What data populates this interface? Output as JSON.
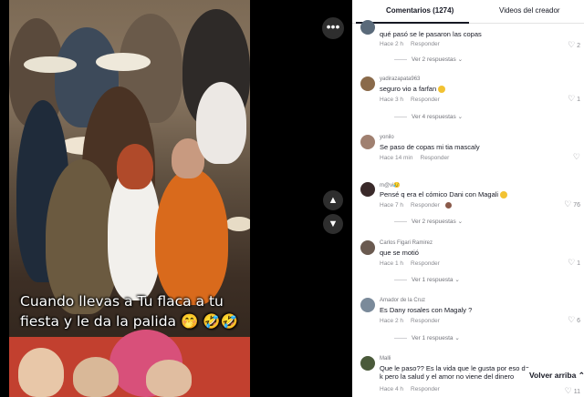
{
  "video": {
    "caption": "Cuando llevas a Tu flaca a tu fiesta y le da la palida 🤭 🤣🤣"
  },
  "tabs": [
    {
      "label": "Comentarios (1274)",
      "active": true
    },
    {
      "label": "Videos del creador",
      "active": false
    }
  ],
  "comments": [
    {
      "user": "",
      "text": "qué pasó se le pasaron las copas",
      "time": "Hace 2 h",
      "reply_label": "Responder",
      "likes": "2",
      "replies": "Ver 2 respuestas",
      "avatar_color": "#5a6a7a"
    },
    {
      "user": "yadirazapata963",
      "text": "seguro vio a farfan",
      "time": "Hace 3 h",
      "reply_label": "Responder",
      "likes": "1",
      "replies": "Ver 4 respuestas",
      "avatar_color": "#8a6a4a"
    },
    {
      "user": "yonilo",
      "text": "Se paso de copas mi tia mascaly",
      "time": "Hace 14 min",
      "reply_label": "Responder",
      "likes": "",
      "replies": "",
      "avatar_color": "#a08070"
    },
    {
      "user": "m@vi😥",
      "text": "Pensé q era el cómico Dani con Magali",
      "time": "Hace 7 h",
      "reply_label": "Responder",
      "likes": "76",
      "replies": "Ver 2 respuestas",
      "avatar_color": "#3a2a2a"
    },
    {
      "user": "Carlos Figari Ramirez",
      "text": "que se motió",
      "time": "Hace 1 h",
      "reply_label": "Responder",
      "likes": "1",
      "replies": "Ver 1 respuesta",
      "avatar_color": "#6a5a50"
    },
    {
      "user": "Amador de la Cruz",
      "text": "Es Dany rosales con Magaly ?",
      "time": "Hace 2 h",
      "reply_label": "Responder",
      "likes": "6",
      "replies": "Ver 1 respuesta",
      "avatar_color": "#7a8a9a"
    },
    {
      "user": "Malli",
      "text": "Que le paso?? Es la vida que le gusta por eso de",
      "text2": "k pero la salud y el amor no viene del dinero",
      "time": "Hace 4 h",
      "reply_label": "Responder",
      "likes": "11",
      "replies": "",
      "avatar_color": "#4a5a3a"
    }
  ],
  "back_to_top": "Volver arriba",
  "icons": {
    "more": "more-dots-icon",
    "up": "chevron-up-icon",
    "down": "chevron-down-icon",
    "heart": "heart-icon"
  }
}
